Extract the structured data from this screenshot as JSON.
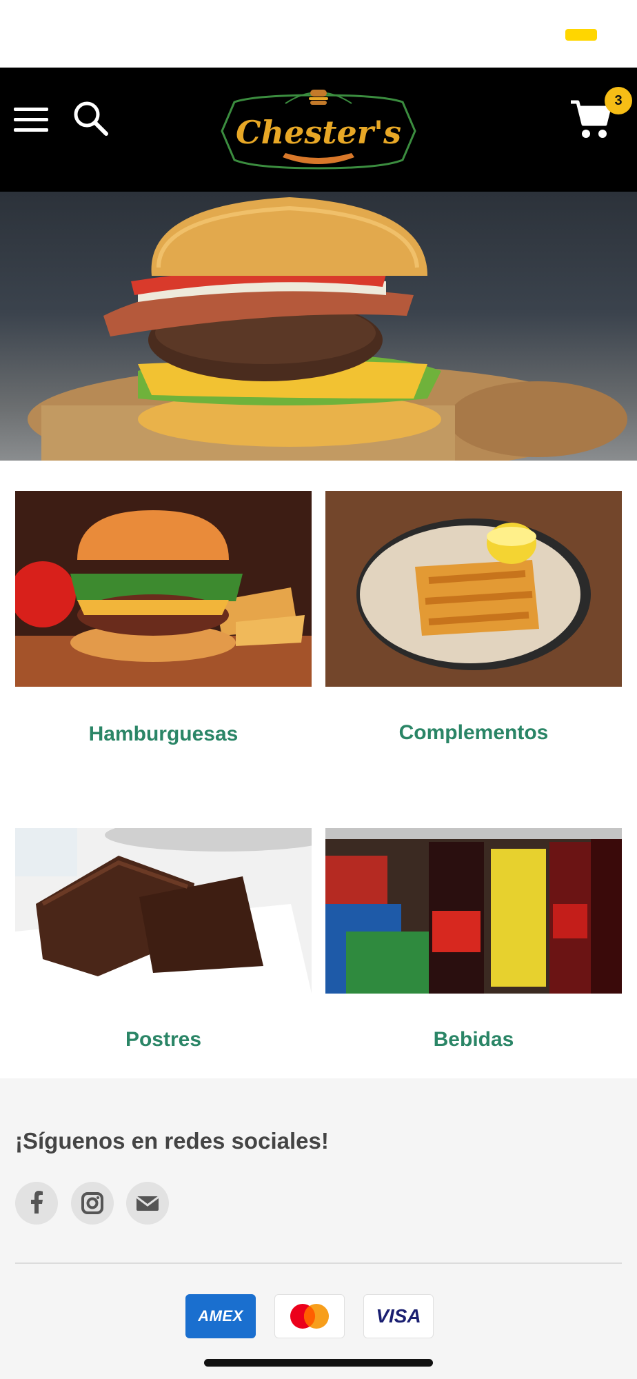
{
  "header": {
    "brand": "Chester's",
    "cart_count": "3"
  },
  "categories": [
    {
      "label": "Hamburguesas"
    },
    {
      "label": "Complementos"
    },
    {
      "label": "Postres"
    },
    {
      "label": "Bebidas"
    }
  ],
  "footer": {
    "follow_title": "¡Síguenos en redes sociales!",
    "social": [
      "facebook-icon",
      "instagram-icon",
      "email-icon"
    ],
    "payments": {
      "amex": "AMEX",
      "visa": "VISA"
    }
  },
  "colors": {
    "header_bg": "#000000",
    "accent_yellow": "#f6bd16",
    "category_label": "#2a8566",
    "logo_orange": "#e8a826",
    "logo_green": "#3b8d3f"
  }
}
